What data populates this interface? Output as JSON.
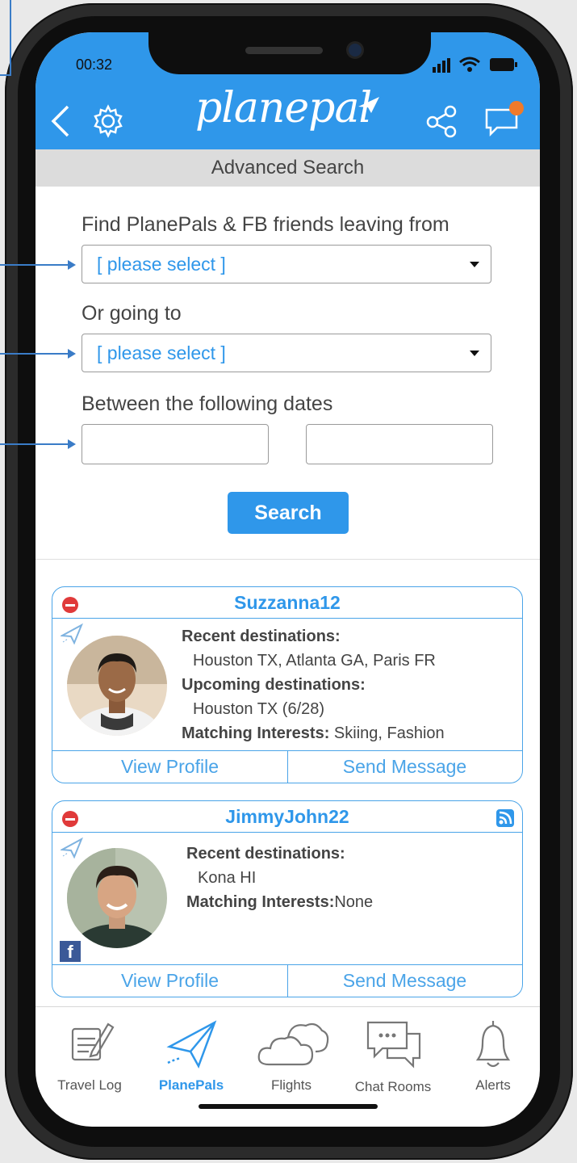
{
  "status": {
    "time": "00:32"
  },
  "header": {
    "logo": "planepal",
    "subtitle": "Advanced Search"
  },
  "form": {
    "leaving_label": "Find PlanePals & FB friends leaving from",
    "leaving_value": "[ please select ]",
    "going_label": "Or going to",
    "going_value": "[ please select ]",
    "dates_label": "Between the following dates",
    "search_label": "Search"
  },
  "results": [
    {
      "username": "Suzzanna12",
      "recent_label": "Recent destinations:",
      "recent": "Houston TX, Atlanta GA, Paris FR",
      "upcoming_label": "Upcoming destinations:",
      "upcoming": "Houston TX (6/28)",
      "interests_label": "Matching Interests:",
      "interests": " Skiing, Fashion",
      "view_profile": "View Profile",
      "send_message": "Send Message"
    },
    {
      "username": "JimmyJohn22",
      "recent_label": "Recent destinations:",
      "recent": "Kona HI",
      "interests_label": "Matching Interests:",
      "interests": "None",
      "facebook_badge": "f",
      "view_profile": "View Profile",
      "send_message": "Send Message"
    }
  ],
  "tabs": [
    {
      "label": "Travel Log",
      "icon": "notepad-pen-icon"
    },
    {
      "label": "PlanePals",
      "icon": "paper-plane-icon",
      "active": true
    },
    {
      "label": "Flights",
      "icon": "clouds-icon"
    },
    {
      "label": "Chat Rooms",
      "icon": "chat-bubbles-icon"
    },
    {
      "label": "Alerts",
      "icon": "bell-icon"
    }
  ],
  "colors": {
    "accent": "#2f97ea",
    "block": "#e03a3a",
    "notification": "#f07a2a"
  }
}
